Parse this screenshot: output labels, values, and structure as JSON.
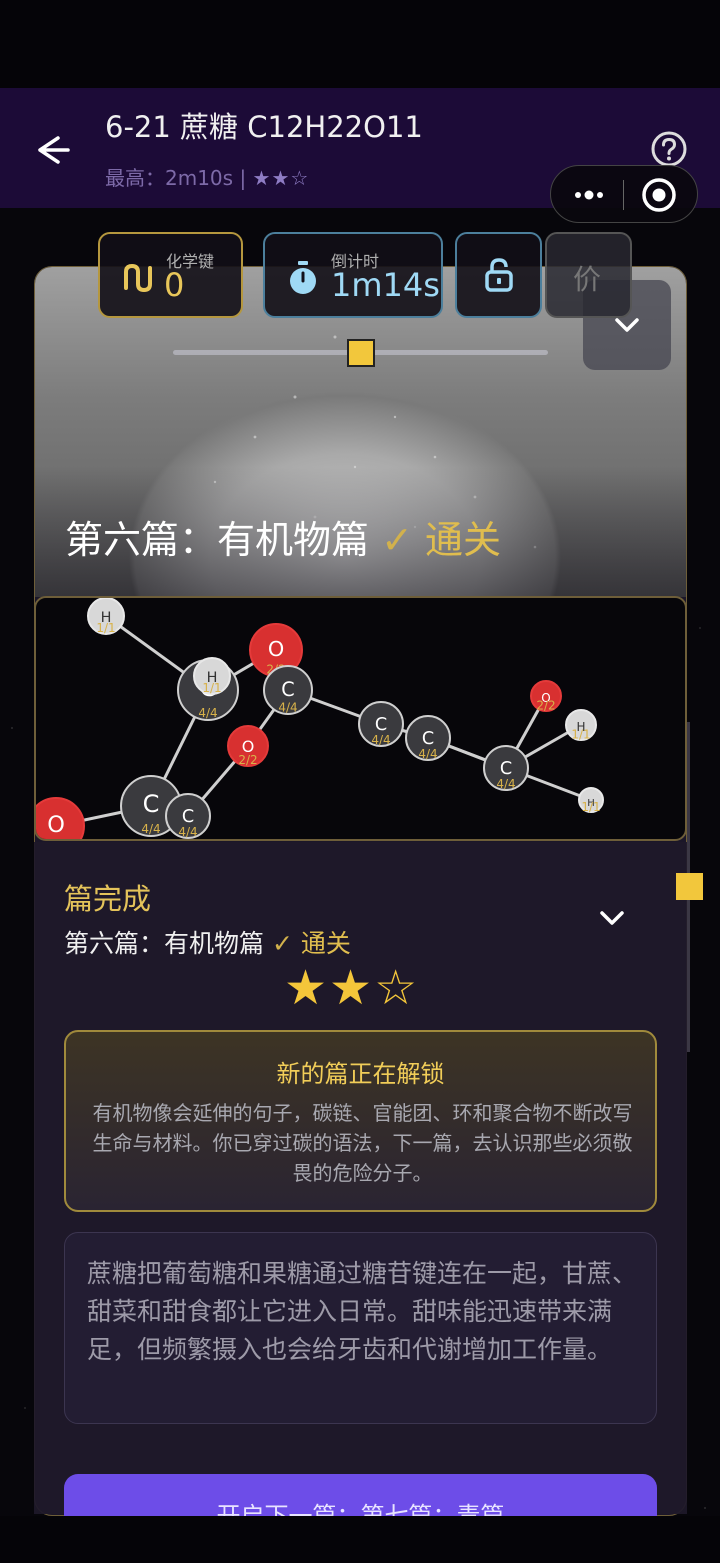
{
  "header": {
    "title": "6-21 蔗糖 C12H22O11",
    "best_label": "最高：",
    "best_time": "2m10s",
    "separator": "|",
    "best_stars": "★★☆"
  },
  "stats": {
    "bonds_label": "化学键",
    "bonds_value": "0",
    "timer_label": "倒计时",
    "timer_value": "1m14s",
    "price_glyph": "价"
  },
  "hero": {
    "chapter": "第六篇：有机物篇",
    "check": "✓",
    "status": "通关"
  },
  "slider": {
    "level": 0.5
  },
  "molecule": {
    "atoms": [
      {
        "el": "H",
        "label": "1/1"
      },
      {
        "el": "C",
        "label": "4/4"
      },
      {
        "el": "O",
        "label": "2/2"
      },
      {
        "el": "C",
        "label": "4/4"
      },
      {
        "el": "H",
        "label": "1/1"
      },
      {
        "el": "C",
        "label": "4/4"
      },
      {
        "el": "O",
        "label": "2/2"
      },
      {
        "el": "C",
        "label": "4/4"
      },
      {
        "el": "C",
        "label": "4/4"
      },
      {
        "el": "O",
        "label": "2/2"
      },
      {
        "el": "H",
        "label": "1/1"
      },
      {
        "el": "O",
        "label": "2/2"
      },
      {
        "el": "C",
        "label": "4/4"
      },
      {
        "el": "C",
        "label": "4/4"
      },
      {
        "el": "H",
        "label": "1/1"
      }
    ]
  },
  "completion": {
    "heading": "篇完成",
    "chapter": "第六篇：有机物篇",
    "check": "✓",
    "status": "通关",
    "rating_stars": "★★☆",
    "unlock_title": "新的篇正在解锁",
    "unlock_body": "有机物像会延伸的句子，碳链、官能团、环和聚合物不断改写生命与材料。你已穿过碳的语法，下一篇，去认识那些必须敬畏的危险分子。",
    "description": "蔗糖把葡萄糖和果糖通过糖苷键连在一起，甘蔗、甜菜和甜食都让它进入日常。甜味能迅速带来满足，但频繁摄入也会给牙齿和代谢增加工作量。",
    "next_button": "开启下一篇：第七篇：毒篇"
  },
  "icons": {
    "back": "arrow-left-icon",
    "help": "question-circle-icon",
    "more": "more-dots-icon",
    "target": "target-icon",
    "bonds": "bond-icon",
    "timer": "stopwatch-icon",
    "lock": "lock-icon",
    "collapse": "chevron-down-icon"
  },
  "colors": {
    "header_bg": "#1c0b37",
    "accent_gold": "#e0bd4e",
    "timer_blue": "#9fd9f5",
    "button_purple": "#6d4de8"
  }
}
